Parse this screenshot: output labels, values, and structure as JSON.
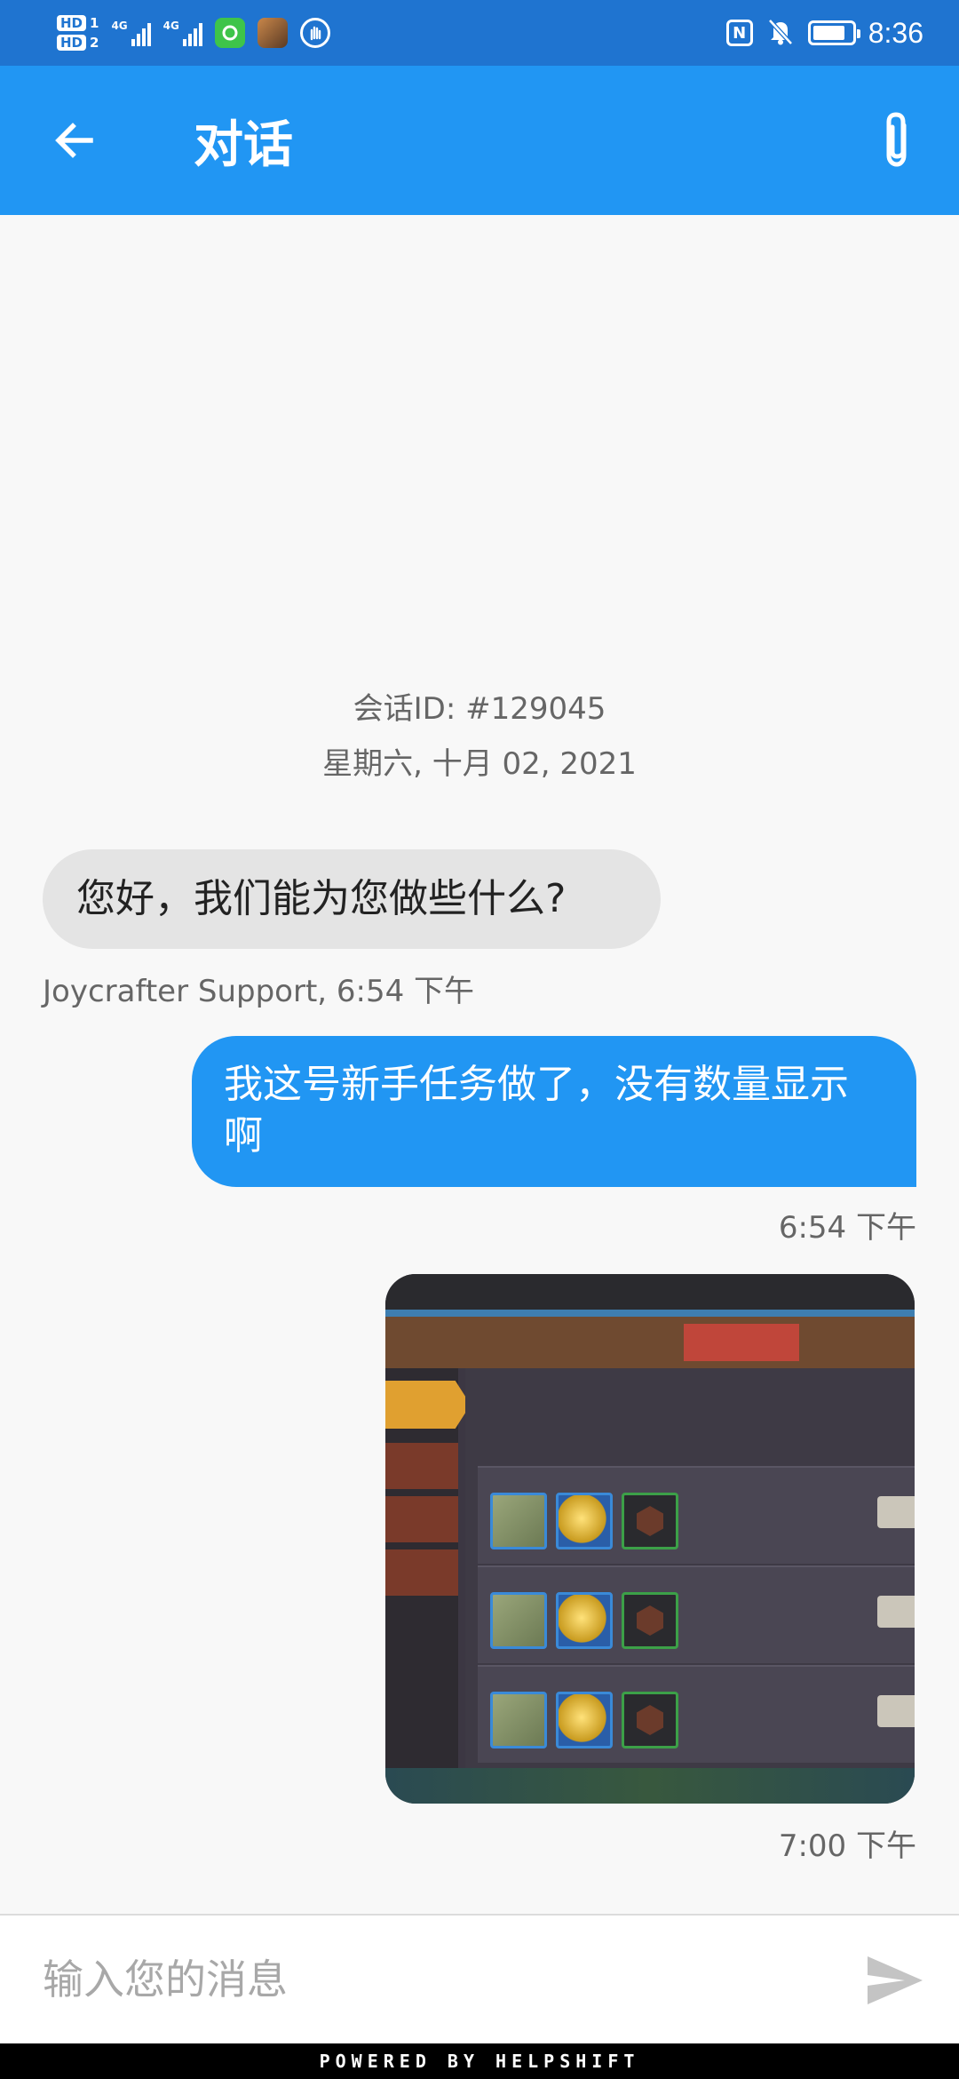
{
  "status_bar": {
    "hd1": "HD",
    "hd1_num": "1",
    "hd2": "HD",
    "hd2_num": "2",
    "net1": "4G",
    "net2": "4G",
    "nfc": "N",
    "time": "8:36",
    "battery_level": 0.85
  },
  "appbar": {
    "title": "对话",
    "back_icon": "arrow-left-icon",
    "attach_icon": "paperclip-icon"
  },
  "conversation": {
    "id_label": "会话ID: #129045",
    "date": "星期六, 十月 02, 2021",
    "messages": [
      {
        "direction": "incoming",
        "text": "您好，我们能为您做些什么?",
        "meta": "Joycrafter Support, 6:54 下午"
      },
      {
        "direction": "outgoing",
        "text": "我这号新手任务做了，没有数量显示啊",
        "meta": "6:54 下午"
      },
      {
        "direction": "outgoing",
        "type": "image",
        "meta": "7:00 下午"
      }
    ]
  },
  "input": {
    "placeholder": "输入您的消息",
    "value": "",
    "send_icon": "send-icon"
  },
  "footer": {
    "text": "POWERED BY HELPSHIFT"
  },
  "colors": {
    "status_bar": "#1f74d0",
    "app_bar": "#2196f3",
    "incoming_bubble": "#e4e4e4",
    "outgoing_bubble": "#2196f3",
    "background": "#f8f8f8"
  }
}
